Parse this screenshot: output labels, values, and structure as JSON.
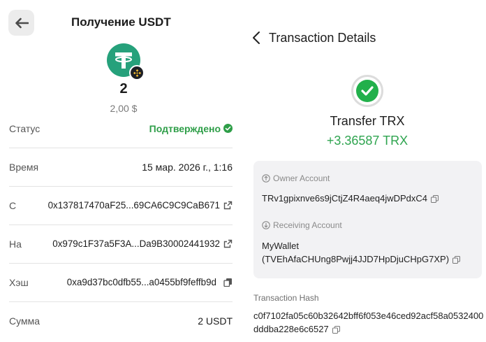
{
  "left": {
    "title": "Получение USDT",
    "amount": "2",
    "fiat": "2,00 $",
    "rows": [
      {
        "label": "Статус",
        "value": "Подтверждено"
      },
      {
        "label": "Время",
        "value": "15 мар. 2026 г., 1:16"
      },
      {
        "label": "С",
        "value": "0x137817470aF25...69CA6C9C9CaB671"
      },
      {
        "label": "На",
        "value": "0x979c1F37a5F3A...Da9B30002441932"
      },
      {
        "label": "Хэш",
        "value": "0xa9d37bc0dfb55...a0455bf9feffb9d"
      },
      {
        "label": "Сумма",
        "value": "2 USDT"
      }
    ],
    "icons": [
      "back-arrow-icon",
      "usdt-token-icon",
      "bnb-chain-icon",
      "check-circle-icon",
      "external-link-icon",
      "copy-icon"
    ],
    "colors": {
      "status": "#2e9e48",
      "token": "#26a17b"
    }
  },
  "right": {
    "title": "Transaction Details",
    "type": "Transfer TRX",
    "amount": "+3.36587 TRX",
    "owner_label": "Owner Account",
    "owner_value": "TRv1gpixnve6s9jCtjZ4R4aeq4jwDPdxC4",
    "receiving_label": "Receiving Account",
    "receiving_name": "MyWallet",
    "receiving_value": "(TVEhAfaCHUng8Pwjj4JJD7HpDjuCHpG7XP)",
    "hash_label": "Transaction Hash",
    "hash_value": "c0f7102fa05c60b32642bff6f053e46ced92acf58a0532400dddba228e6c6527",
    "icons": [
      "chevron-left-icon",
      "success-check-icon",
      "arrow-up-circle-icon",
      "arrow-down-circle-icon",
      "copy-icon"
    ],
    "colors": {
      "amount": "#2ea44f",
      "success": "#22b04b"
    }
  }
}
